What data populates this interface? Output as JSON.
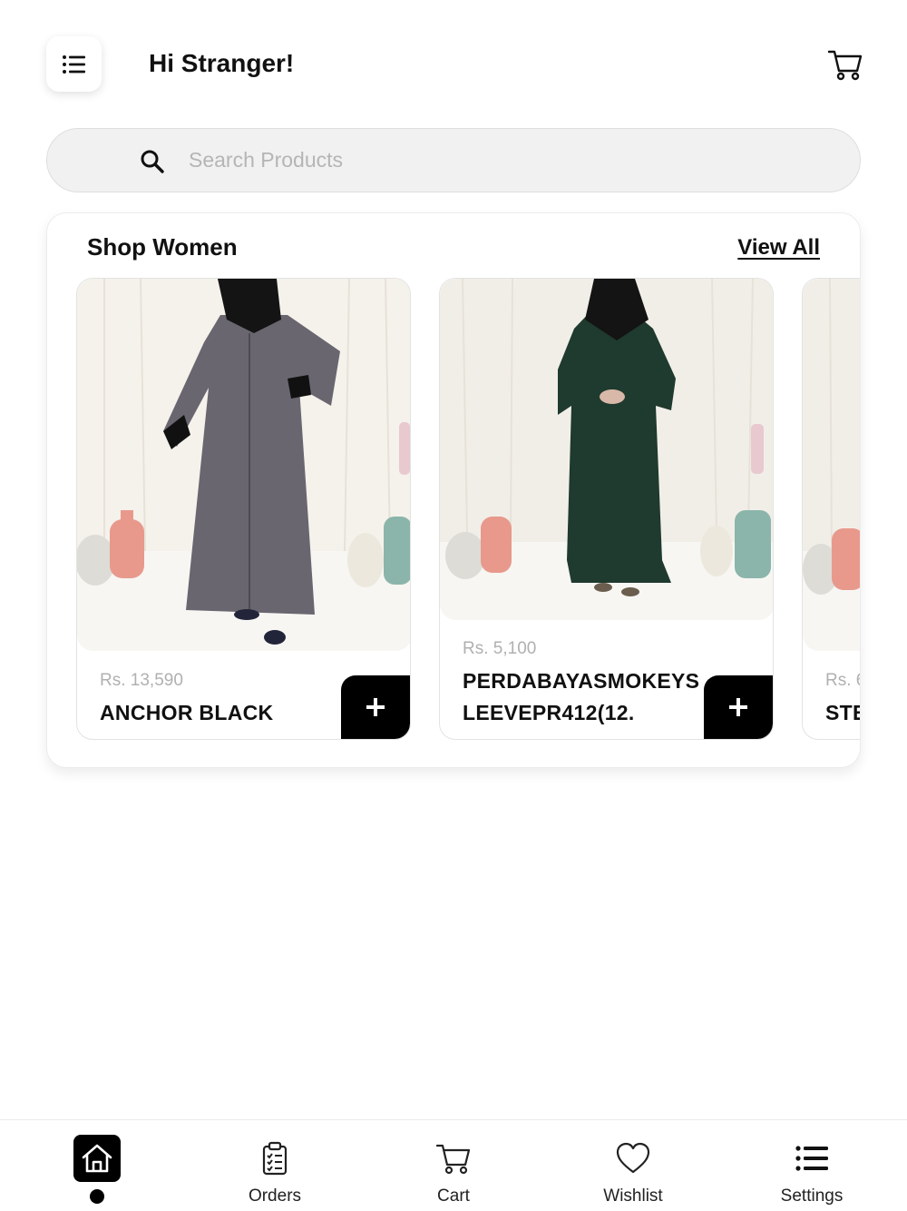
{
  "header": {
    "greeting": "Hi Stranger!"
  },
  "search": {
    "placeholder": "Search Products"
  },
  "section": {
    "title": "Shop Women",
    "view_all": "View All",
    "products": [
      {
        "price": "Rs. 13,590",
        "name": "ANCHOR BLACK",
        "dress_color": "#6a6670"
      },
      {
        "price": "Rs. 5,100",
        "name": "PERDABAYASMOKEYS LEEVEPR412(12.",
        "dress_color": "#1f3a2e"
      },
      {
        "price": "Rs. 6",
        "name": "STE"
      }
    ]
  },
  "bottom_nav": {
    "items": [
      {
        "label": "",
        "icon": "home-icon",
        "active": true
      },
      {
        "label": "Orders",
        "icon": "clipboard-icon"
      },
      {
        "label": "Cart",
        "icon": "cart-icon"
      },
      {
        "label": "Wishlist",
        "icon": "heart-icon"
      },
      {
        "label": "Settings",
        "icon": "list-icon"
      }
    ]
  },
  "colors": {
    "accent": "#000000",
    "muted_text": "#b0b0b0",
    "search_bg": "#f1f1f1"
  }
}
